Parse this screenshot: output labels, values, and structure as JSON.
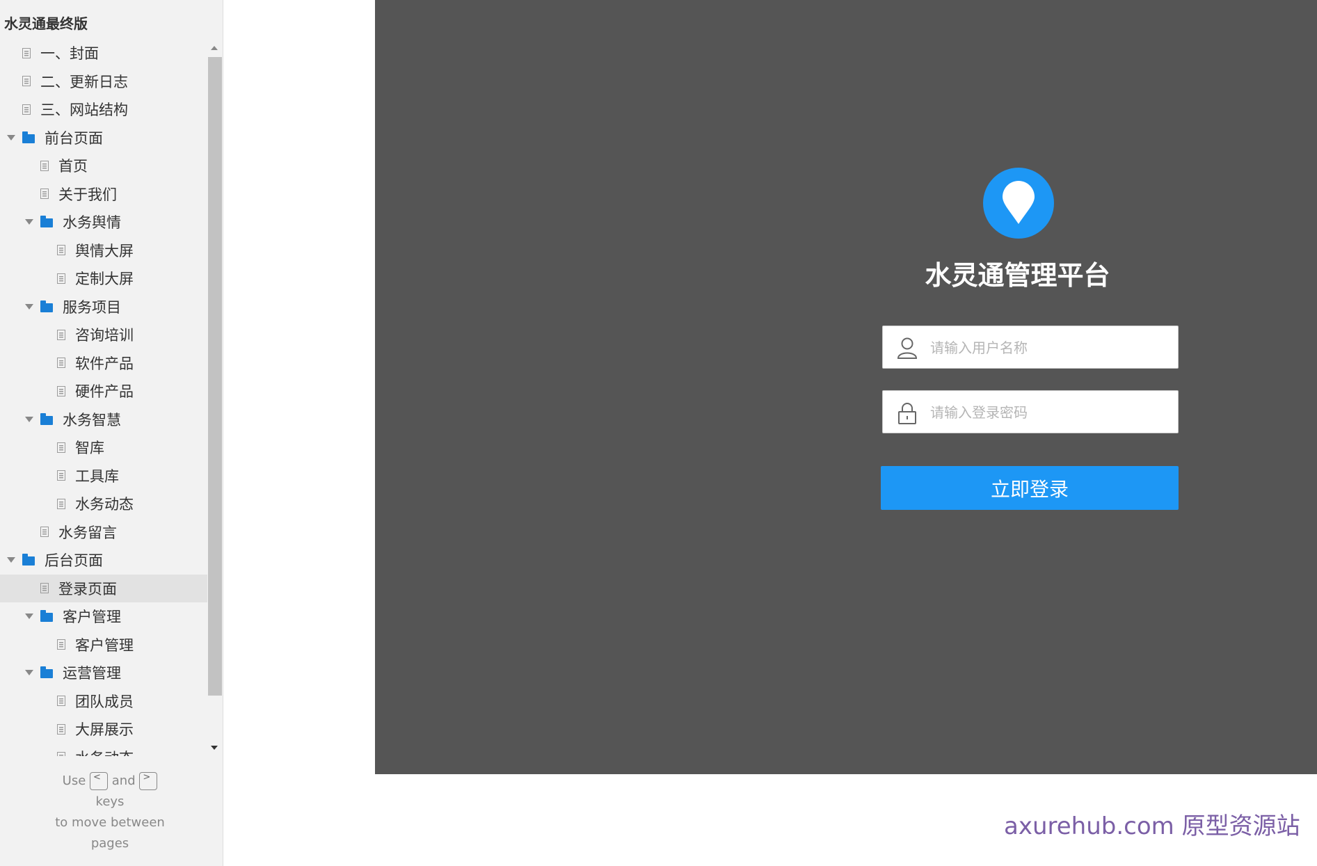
{
  "sidebar": {
    "project_title": "水灵通最终版",
    "items": [
      {
        "label": "一、封面",
        "type": "page",
        "level": 0
      },
      {
        "label": "二、更新日志",
        "type": "page",
        "level": 0
      },
      {
        "label": "三、网站结构",
        "type": "page",
        "level": 0
      },
      {
        "label": "前台页面",
        "type": "folder",
        "level": 0
      },
      {
        "label": "首页",
        "type": "page",
        "level": 1
      },
      {
        "label": "关于我们",
        "type": "page",
        "level": 1
      },
      {
        "label": "水务舆情",
        "type": "folder",
        "level": 1
      },
      {
        "label": "舆情大屏",
        "type": "page",
        "level": 2
      },
      {
        "label": "定制大屏",
        "type": "page",
        "level": 2
      },
      {
        "label": "服务项目",
        "type": "folder",
        "level": 1
      },
      {
        "label": "咨询培训",
        "type": "page",
        "level": 2
      },
      {
        "label": "软件产品",
        "type": "page",
        "level": 2
      },
      {
        "label": "硬件产品",
        "type": "page",
        "level": 2
      },
      {
        "label": "水务智慧",
        "type": "folder",
        "level": 1
      },
      {
        "label": "智库",
        "type": "page",
        "level": 2
      },
      {
        "label": "工具库",
        "type": "page",
        "level": 2
      },
      {
        "label": "水务动态",
        "type": "page",
        "level": 2
      },
      {
        "label": "水务留言",
        "type": "page",
        "level": 1
      },
      {
        "label": "后台页面",
        "type": "folder",
        "level": 0
      },
      {
        "label": "登录页面",
        "type": "page",
        "level": 1,
        "selected": true
      },
      {
        "label": "客户管理",
        "type": "folder",
        "level": 1
      },
      {
        "label": "客户管理",
        "type": "page",
        "level": 2
      },
      {
        "label": "运营管理",
        "type": "folder",
        "level": 1
      },
      {
        "label": "团队成员",
        "type": "page",
        "level": 2
      },
      {
        "label": "大屏展示",
        "type": "page",
        "level": 2
      },
      {
        "label": "水务动态",
        "type": "page",
        "level": 2
      }
    ],
    "hint": {
      "use": "Use",
      "key_left": "<",
      "and": "and",
      "key_right": ">",
      "line2": "keys",
      "line3": "to move between",
      "line4": "pages"
    }
  },
  "login": {
    "logo_icon": "location-pin-icon",
    "title": "水灵通管理平台",
    "username_placeholder": "请输入用户名称",
    "password_placeholder": "请输入登录密码",
    "submit_label": "立即登录"
  },
  "watermark": "axurehub.com 原型资源站",
  "colors": {
    "accent": "#1d97f5",
    "panel_bg": "#555555",
    "sidebar_bg": "#f2f2f2",
    "folder": "#1a7fd6"
  }
}
